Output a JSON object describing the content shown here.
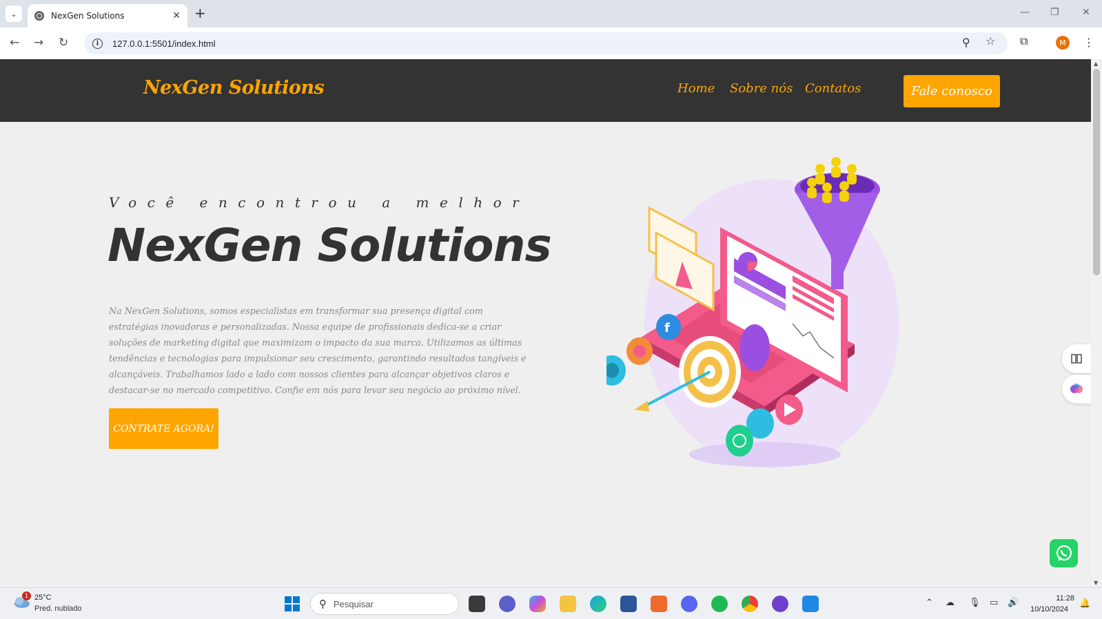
{
  "browser": {
    "tab_title": "NexGen Solutions",
    "tab_close": "✕",
    "new_tab": "+",
    "url": "127.0.0.1:5501/index.html",
    "avatar_letter": "M",
    "win_minimize": "—",
    "win_restore": "❐",
    "win_close": "✕"
  },
  "header": {
    "logo": "NexGen Solutions",
    "nav": [
      "Home",
      "Sobre nós",
      "Contatos"
    ],
    "cta": "Fale conosco"
  },
  "hero": {
    "pre_title": "Você encontrou a melhor",
    "title": "NexGen Solutions",
    "description": "Na NexGen Solutions, somos especialistas em transformar sua presença digital com estratégias inovadoras e personalizadas. Nossa equipe de profissionais dedica-se a criar soluções de marketing digital que maximizam o impacto da sua marca. Utilizamos as últimas tendências e tecnologias para impulsionar seu crescimento, garantindo resultados tangíveis e alcançáveis. Trabalhamos lado a lado com nossos clientes para alcançar objetivos claros e destacar-se no mercado competitivo. Confie em nós para levar seu negócio ao próximo nível.",
    "button": "CONTRATE AGORA!"
  },
  "taskbar": {
    "weather_badge": "1",
    "temperature": "25°C",
    "weather_desc": "Pred. nublado",
    "search_placeholder": "Pesquisar",
    "time": "11:28",
    "date": "10/10/2024"
  },
  "colors": {
    "accent": "#ffa500",
    "header_bg": "#333333",
    "page_bg": "#efefef",
    "whatsapp": "#25d366"
  }
}
